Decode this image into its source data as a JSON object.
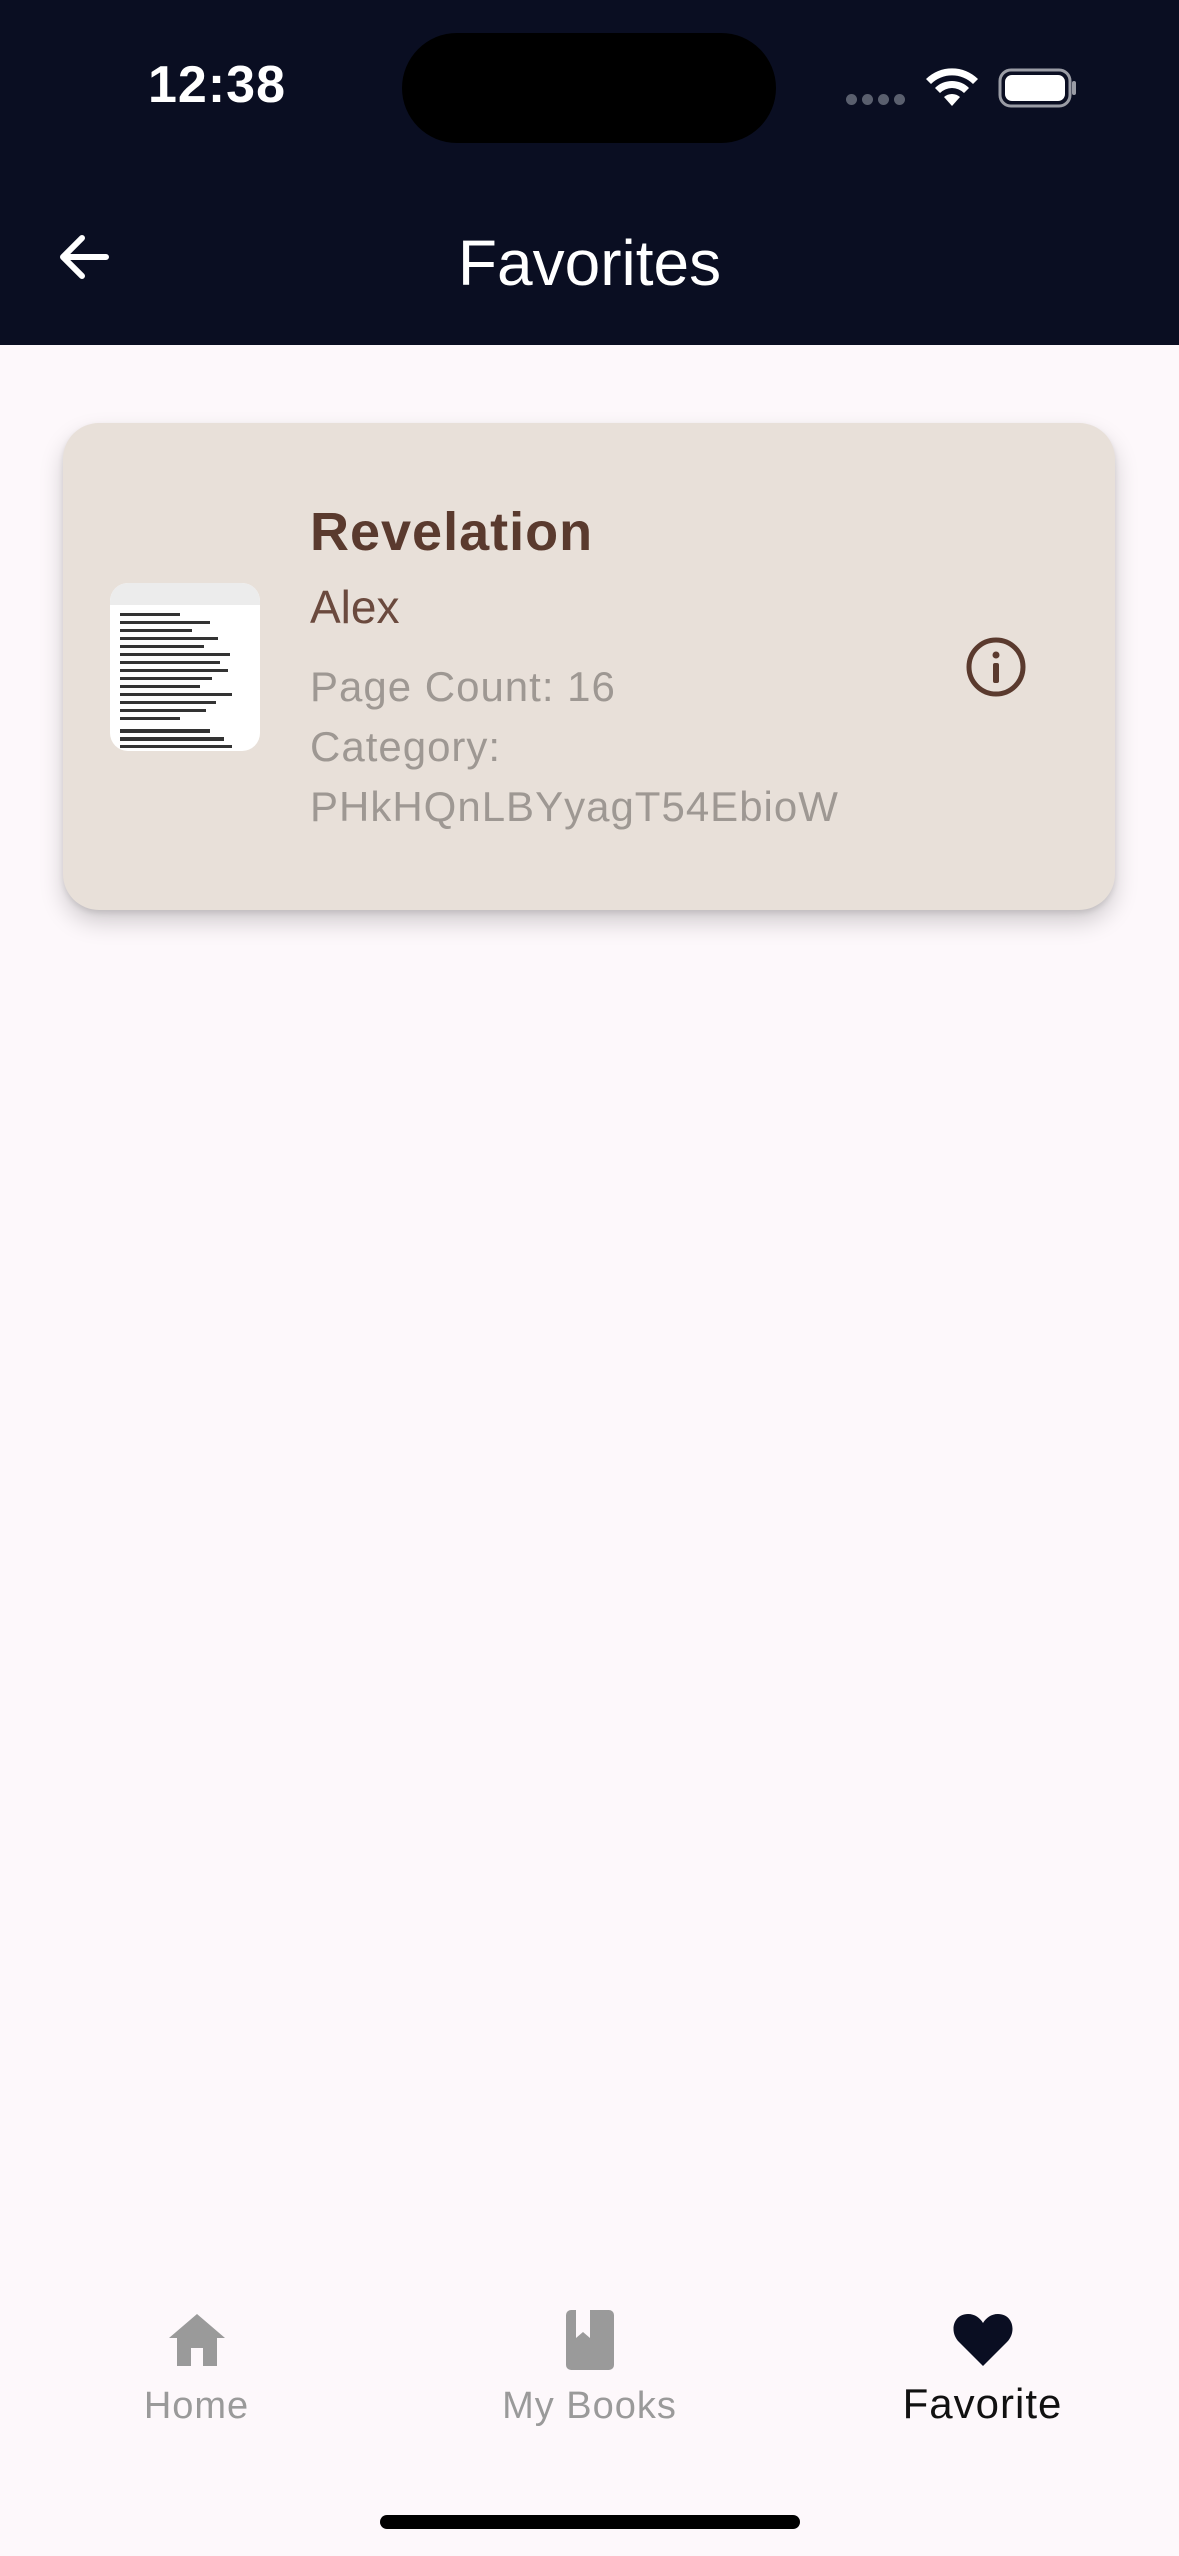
{
  "status_bar": {
    "time": "12:38"
  },
  "header": {
    "title": "Favorites",
    "back_icon": "arrow-left-icon"
  },
  "favorites": [
    {
      "title": "Revelation",
      "author": "Alex",
      "page_count": "Page Count: 16",
      "category_label": "Category:",
      "category_value": "PHkHQnLBYyagT54EbioW",
      "info_icon": "info-circle-icon"
    }
  ],
  "bottom_nav": {
    "items": [
      {
        "label": "Home",
        "icon": "home-icon",
        "active": false
      },
      {
        "label": "My Books",
        "icon": "book-icon",
        "active": false
      },
      {
        "label": "Favorite",
        "icon": "heart-icon",
        "active": true
      }
    ]
  },
  "colors": {
    "header_bg": "#0A0E22",
    "card_bg": "#E8E0D9",
    "title_brown": "#5A3A2E",
    "muted_text": "#9E9893",
    "page_bg": "#FDF8FB"
  }
}
